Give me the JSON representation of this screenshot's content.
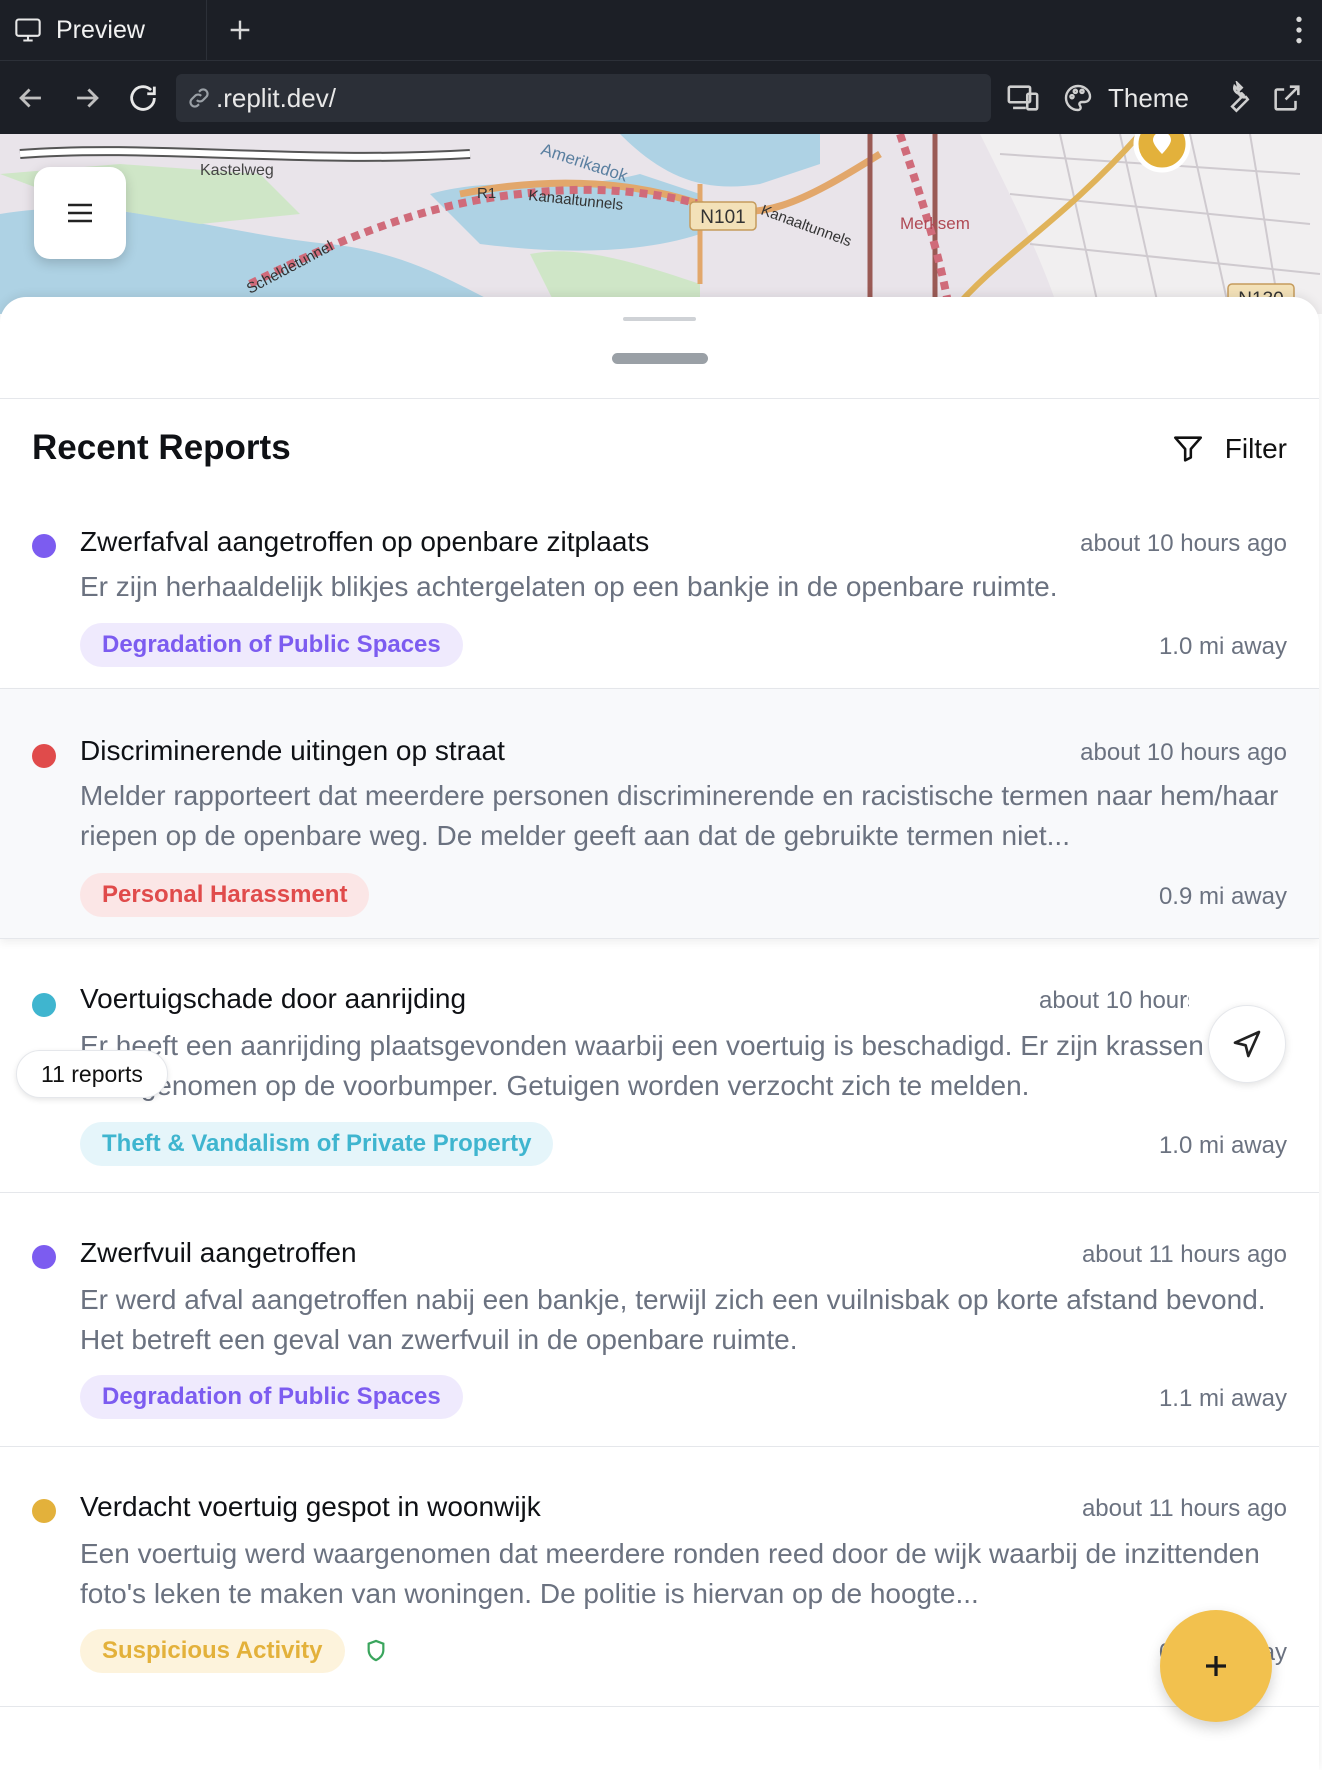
{
  "browser": {
    "tab_label": "Preview",
    "url": ".replit.dev/",
    "theme_label": "Theme"
  },
  "map": {
    "labels": [
      "Kastelweg",
      "Amerikadok",
      "R1",
      "Kanaaltunnels",
      "N101",
      "Kanaaltunnels",
      "Merksem",
      "N130",
      "Scheldetunnel"
    ]
  },
  "sheet": {
    "title": "Recent Reports",
    "filter_label": "Filter",
    "reports_count_label": "11 reports"
  },
  "reports": [
    {
      "title": "Zwerfafval aangetroffen op openbare zitplaats",
      "time": "about 10 hours ago",
      "description": "Er zijn herhaaldelijk blikjes achtergelaten op een bankje in de openbare ruimte.",
      "category": "Degradation of Public Spaces",
      "distance": "1.0 mi away",
      "color": "#7c5cf0"
    },
    {
      "title": "Discriminerende uitingen op straat",
      "time": "about 10 hours ago",
      "description": "Melder rapporteert dat meerdere personen discriminerende en racistische termen naar hem/haar riepen op de openbare weg. De melder geeft aan dat de gebruikte termen niet...",
      "category": "Personal Harassment",
      "distance": "0.9 mi away",
      "color": "#e04b4b"
    },
    {
      "title": "Voertuigschade door aanrijding",
      "time": "about 10 hours ago",
      "description": "Er heeft een aanrijding plaatsgevonden waarbij een voertuig is beschadigd. Er zijn krassen waargenomen op de voorbumper. Getuigen worden verzocht zich te melden.",
      "category": "Theft & Vandalism of Private Property",
      "distance": "1.0 mi away",
      "color": "#3fb5cf"
    },
    {
      "title": "Zwerfvuil aangetroffen",
      "time": "about 11 hours ago",
      "description": "Er werd afval aangetroffen nabij een bankje, terwijl zich een vuilnisbak op korte afstand bevond. Het betreft een geval van zwerfvuil in de openbare ruimte.",
      "category": "Degradation of Public Spaces",
      "distance": "1.1 mi away",
      "color": "#7c5cf0"
    },
    {
      "title": "Verdacht voertuig gespot in woonwijk",
      "time": "about 11 hours ago",
      "description": "Een voertuig werd waargenomen dat meerdere ronden reed door de wijk waarbij de inzittenden foto's leken te maken van woningen. De politie is hiervan op de hoogte...",
      "category": "Suspicious Activity",
      "distance": "0.9 mi away",
      "color": "#e3b13b"
    }
  ],
  "colors": {
    "purple_bg": "#efeafd",
    "red_bg": "#fbe6e6",
    "teal_bg": "#e5f5fa",
    "yellow_bg": "#fdf3dc",
    "fab": "#f2c14e"
  },
  "icons": [
    "monitor-icon",
    "plus-icon",
    "kebab-icon",
    "back-icon",
    "forward-icon",
    "reload-icon",
    "link-icon",
    "devices-icon",
    "palette-icon",
    "wrench-icon",
    "external-link-icon",
    "hamburger-icon",
    "filter-icon",
    "navigate-icon",
    "shield-icon",
    "plus-icon"
  ]
}
